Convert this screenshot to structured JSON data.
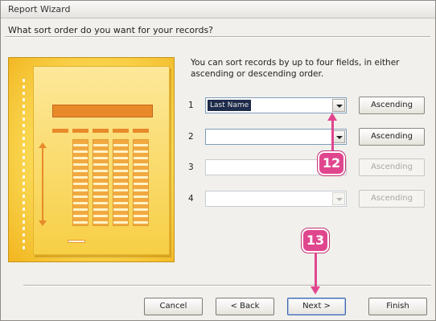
{
  "window": {
    "title": "Report Wizard",
    "question": "What sort order do you want for your records?"
  },
  "instructions": "You can sort records by up to four fields, in either ascending or descending order.",
  "sort_rows": [
    {
      "number": "1",
      "value": "Last Name",
      "order": "Ascending",
      "enabled": true
    },
    {
      "number": "2",
      "value": "",
      "order": "Ascending",
      "enabled": true
    },
    {
      "number": "3",
      "value": "",
      "order": "Ascending",
      "enabled": false
    },
    {
      "number": "4",
      "value": "",
      "order": "Ascending",
      "enabled": false
    }
  ],
  "buttons": {
    "cancel": "Cancel",
    "back": "< Back",
    "next": "Next >",
    "finish": "Finish"
  },
  "callouts": {
    "step12": "12",
    "step13": "13"
  },
  "colors": {
    "callout": "#e0468e",
    "preview": "#f7cf45"
  }
}
